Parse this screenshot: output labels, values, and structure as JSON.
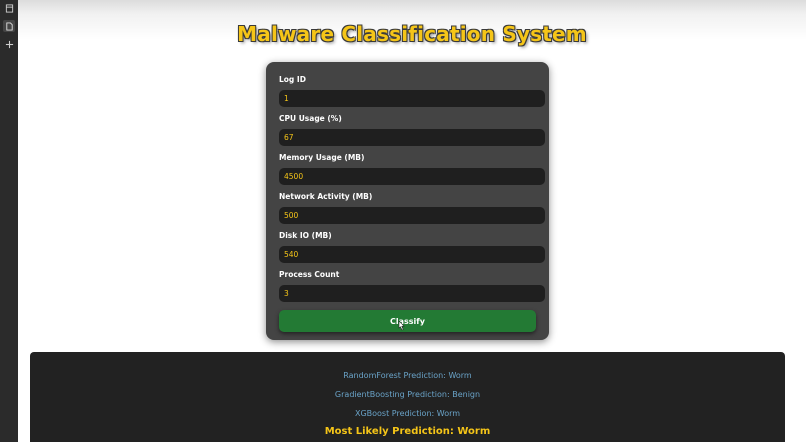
{
  "app": {
    "title": "Malware Classification System"
  },
  "form": {
    "fields": [
      {
        "label": "Log ID",
        "value": "1"
      },
      {
        "label": "CPU Usage (%)",
        "value": "67"
      },
      {
        "label": "Memory Usage (MB)",
        "value": "4500"
      },
      {
        "label": "Network Activity (MB)",
        "value": "500"
      },
      {
        "label": "Disk IO (MB)",
        "value": "540"
      },
      {
        "label": "Process Count",
        "value": "3"
      }
    ],
    "submit_label": "Classify"
  },
  "results": {
    "predictions": [
      "RandomForest Prediction: Worm",
      "GradientBoosting Prediction: Benign",
      "XGBoost Prediction: Worm"
    ],
    "most_likely": "Most Likely Prediction: Worm"
  },
  "colors": {
    "title": "#f5c518",
    "card": "#444444",
    "input_bg": "#1f1f1f",
    "input_text": "#f5c518",
    "button": "#237a34",
    "results_bg": "#222222",
    "prediction_text": "#6aa3c8"
  },
  "icons": {
    "strip": [
      "page-icon",
      "document-icon",
      "plus-icon"
    ]
  }
}
